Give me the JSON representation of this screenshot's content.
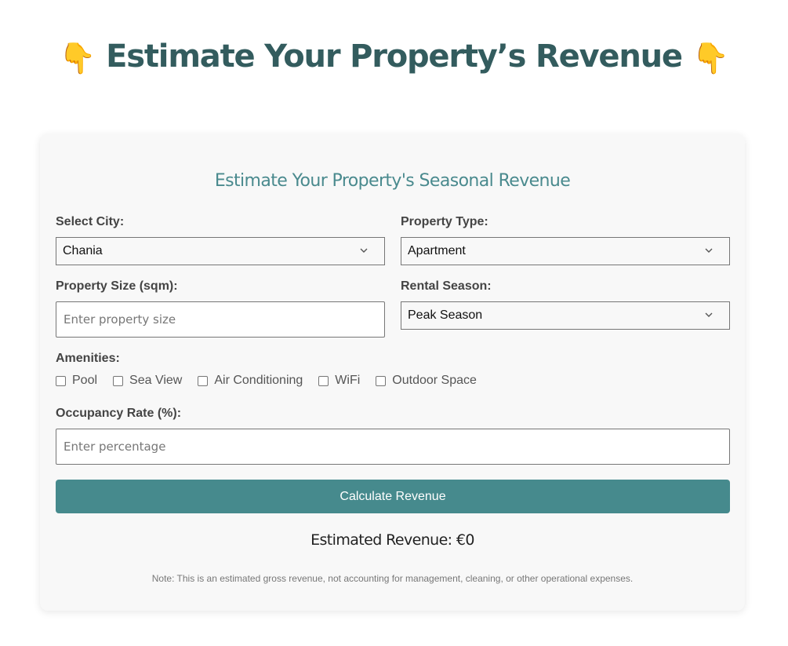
{
  "header": {
    "emoji_left": "👇",
    "title": "Estimate Your Property’s Revenue",
    "emoji_right": "👇"
  },
  "form": {
    "title": "Estimate Your Property's Seasonal Revenue",
    "city": {
      "label": "Select City:",
      "selected": "Chania"
    },
    "property_type": {
      "label": "Property Type:",
      "selected": "Apartment"
    },
    "property_size": {
      "label": "Property Size (sqm):",
      "value": "",
      "placeholder": "Enter property size"
    },
    "rental_season": {
      "label": "Rental Season:",
      "selected": "Peak Season"
    },
    "amenities": {
      "label": "Amenities:",
      "items": [
        {
          "label": "Pool",
          "checked": false
        },
        {
          "label": "Sea View",
          "checked": false
        },
        {
          "label": "Air Conditioning",
          "checked": false
        },
        {
          "label": "WiFi",
          "checked": false
        },
        {
          "label": "Outdoor Space",
          "checked": false
        }
      ]
    },
    "occupancy": {
      "label": "Occupancy Rate (%):",
      "value": "",
      "placeholder": "Enter percentage"
    },
    "submit_label": "Calculate Revenue",
    "result_text": "Estimated Revenue: €0",
    "note": "Note: This is an estimated gross revenue, not accounting for management, cleaning, or other operational expenses."
  },
  "colors": {
    "title": "#335c5e",
    "subtitle": "#4a8a8e",
    "button": "#468a8d",
    "card_bg": "#f8f8f8"
  }
}
